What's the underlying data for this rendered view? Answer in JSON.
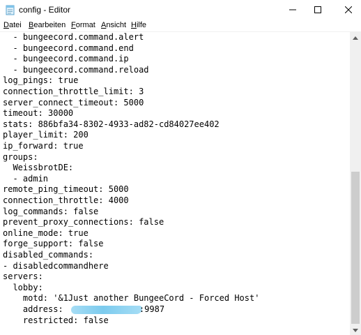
{
  "window": {
    "title": "config - Editor",
    "app_icon": "notepad-icon",
    "controls": {
      "minimize_icon": "minimize-icon",
      "maximize_icon": "maximize-icon",
      "close_icon": "close-icon"
    }
  },
  "menu": {
    "items": [
      {
        "accel": "D",
        "rest": "atei"
      },
      {
        "accel": "B",
        "rest": "earbeiten"
      },
      {
        "accel": "F",
        "rest": "ormat",
        "prefix": ""
      },
      {
        "accel": "A",
        "rest": "nsicht"
      },
      {
        "accel": "H",
        "rest": "ilfe"
      }
    ]
  },
  "editor": {
    "lines": [
      "  - bungeecord.command.alert",
      "  - bungeecord.command.end",
      "  - bungeecord.command.ip",
      "  - bungeecord.command.reload",
      "log_pings: true",
      "connection_throttle_limit: 3",
      "server_connect_timeout: 5000",
      "timeout: 30000",
      "stats: 886bfa34-8302-4933-ad82-cd84027ee402",
      "player_limit: 200",
      "ip_forward: true",
      "groups:",
      "  WeissbrotDE:",
      "  - admin",
      "remote_ping_timeout: 5000",
      "connection_throttle: 4000",
      "log_commands: false",
      "prevent_proxy_connections: false",
      "online_mode: true",
      "forge_support: false",
      "disabled_commands:",
      "- disabledcommandhere",
      "servers:",
      "  lobby:",
      "    motd: '&1Just another BungeeCord - Forced Host'",
      "    address: ",
      "    restricted: false"
    ],
    "address_suffix": ":9987",
    "redaction_color": "#7ccbee"
  },
  "scrollbar": {
    "up_icon": "scroll-up-arrow-icon",
    "down_icon": "scroll-down-arrow-icon",
    "scroll_position": 0.58
  }
}
